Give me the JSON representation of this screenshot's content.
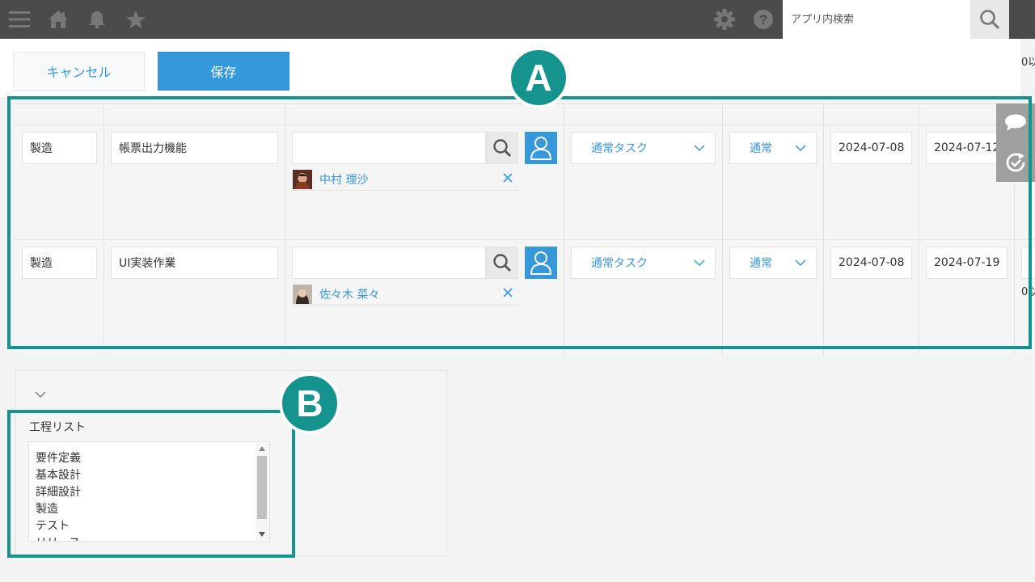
{
  "topbar": {
    "icons": [
      "menu-icon",
      "home-icon",
      "bell-icon",
      "star-icon",
      "gear-icon",
      "help-icon"
    ],
    "search_placeholder": "アプリ内検索"
  },
  "actions": {
    "cancel_label": "キャンセル",
    "save_label": "保存"
  },
  "truncated_label_right": "0以",
  "rows": [
    {
      "process": "製造",
      "task_name": "帳票出力機能",
      "assignee": "中村 理沙",
      "task_type": "通常タスク",
      "priority": "通常",
      "start_date": "2024-07-08",
      "end_date": "2024-07-12"
    },
    {
      "process": "製造",
      "task_name": "UI実装作業",
      "assignee": "佐々木 菜々",
      "task_type": "通常タスク",
      "priority": "通常",
      "start_date": "2024-07-08",
      "end_date": "2024-07-19"
    }
  ],
  "side_tabs": [
    "comment-icon",
    "history-icon"
  ],
  "process_list": {
    "label": "工程リスト",
    "items": [
      "要件定義",
      "基本設計",
      "詳細設計",
      "製造",
      "テスト",
      "リリース"
    ]
  },
  "annotations": {
    "a": "A",
    "b": "B"
  },
  "colors": {
    "accent": "#3498db",
    "topbar": "#4b4b4b",
    "annotation": "#15948f"
  }
}
